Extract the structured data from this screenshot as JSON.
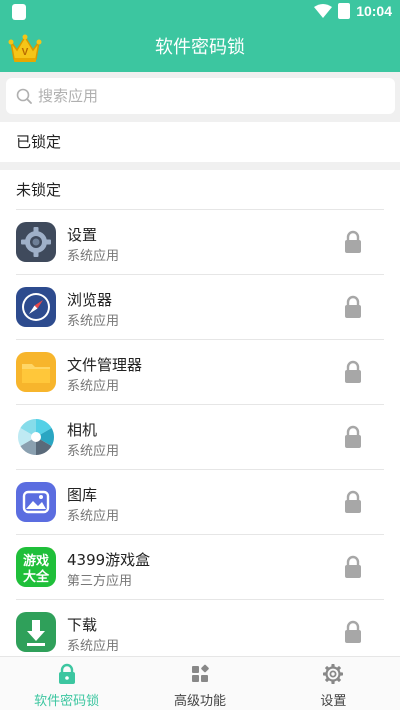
{
  "status_bar": {
    "time": "10:04"
  },
  "header": {
    "title": "软件密码锁",
    "crown_letter": "V"
  },
  "search": {
    "placeholder": "搜索应用",
    "value": ""
  },
  "sections": {
    "locked": "已锁定",
    "unlocked": "未锁定"
  },
  "apps": [
    {
      "name": "设置",
      "type": "系统应用",
      "icon": "settings-app-icon"
    },
    {
      "name": "浏览器",
      "type": "系统应用",
      "icon": "browser-compass-icon"
    },
    {
      "name": "文件管理器",
      "type": "系统应用",
      "icon": "folder-icon"
    },
    {
      "name": "相机",
      "type": "系统应用",
      "icon": "camera-aperture-icon"
    },
    {
      "name": "图库",
      "type": "系统应用",
      "icon": "gallery-icon"
    },
    {
      "name": "4399游戏盒",
      "type": "第三方应用",
      "icon": "game-box-icon",
      "icon_text": [
        "游戏",
        "大全"
      ]
    },
    {
      "name": "下载",
      "type": "系统应用",
      "icon": "download-icon"
    }
  ],
  "bottom_nav": {
    "tabs": [
      {
        "label": "软件密码锁",
        "icon": "lock-icon",
        "active": true
      },
      {
        "label": "高级功能",
        "icon": "grid-icon",
        "active": false
      },
      {
        "label": "设置",
        "icon": "gear-icon",
        "active": false
      }
    ]
  },
  "colors": {
    "accent": "#3cc6a0",
    "lock_gray": "#a7a7a7",
    "background_band": "#f0f0f0"
  }
}
